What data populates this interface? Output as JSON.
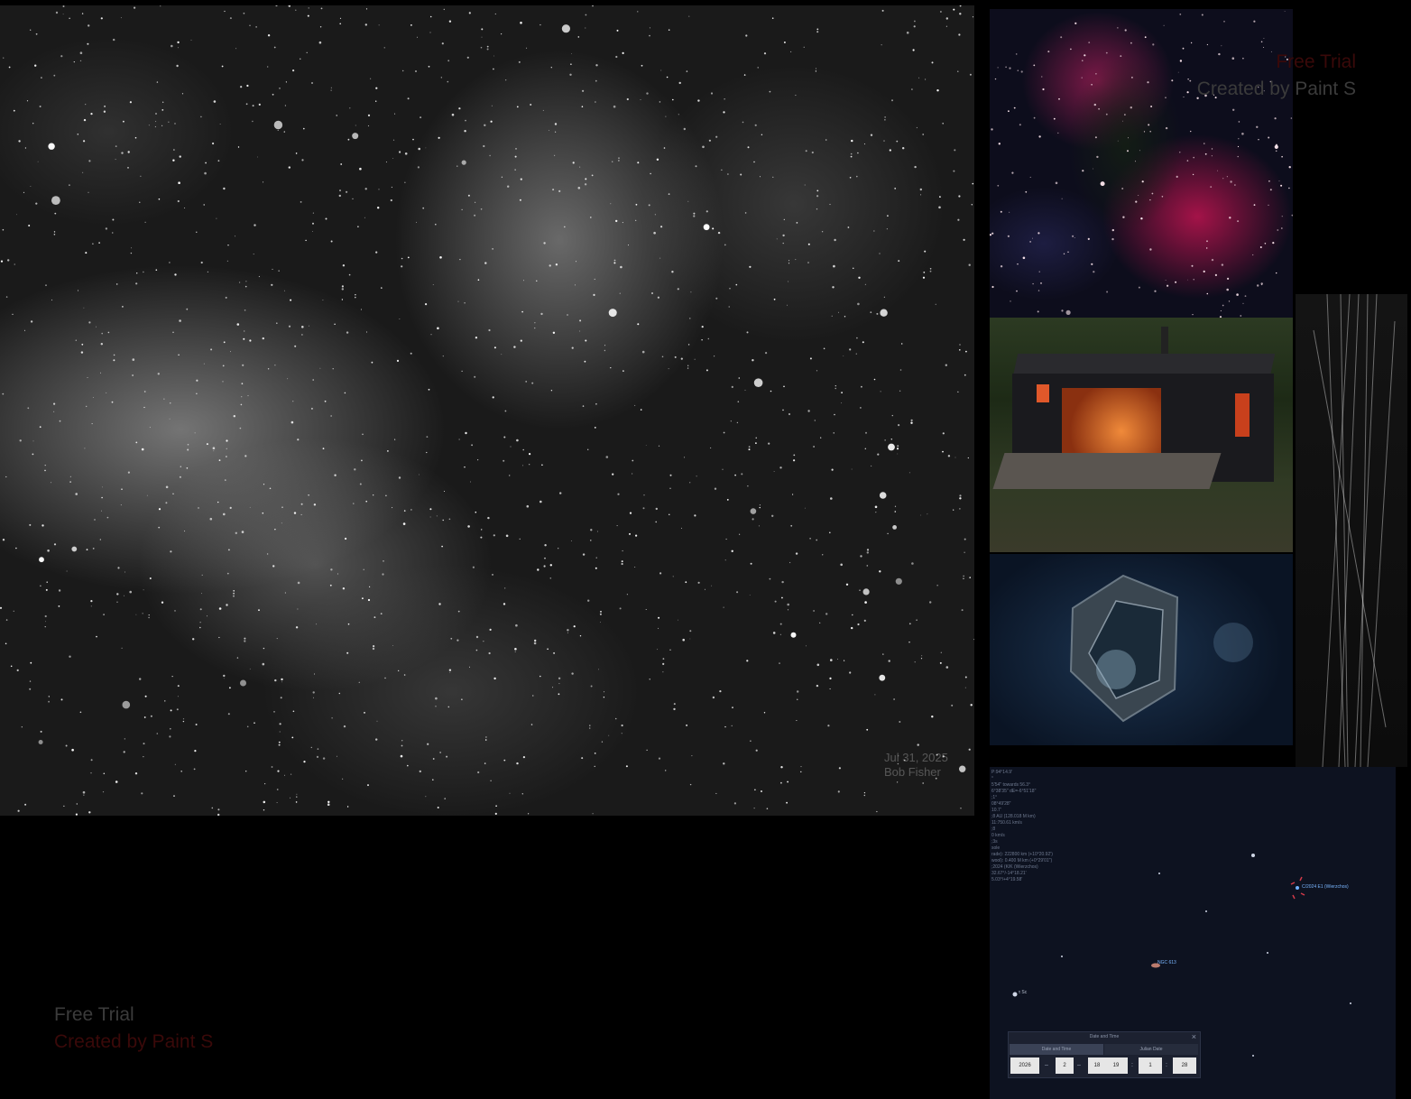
{
  "watermark_top": {
    "line1": "Free Trial",
    "line2": "Created by Paint S"
  },
  "watermark_bottom": {
    "line1": "Free Trial",
    "line2": "Created by Paint S"
  },
  "main_image": {
    "caption_line1": "Jul 31, 2025",
    "caption_line2": "Bob Fisher"
  },
  "stellarium": {
    "info_lines": [
      "P:94°14.9'",
      "°",
      "5'54\" towards 56.3°",
      "6°38'35\"  dE=-6°51'18\"",
      "  ;1°",
      "08°49'28\"",
      "  10.7'",
      "  ;8 AU (128.018 M km)",
      "  11:750.61 km/s",
      "  ;8",
      "  0 km/s",
      "  ;3s",
      "  sole",
      "  rade): 222800 km (+10°20.92')",
      "  wool): 0.400 M km (+0°29'01\")",
      "  ;2024 (K/K (Wierzchos)",
      "  32.67°/-14°18.21'",
      "  5.03°/+4°19.58'"
    ],
    "comet_label": "C/2024 E1 (Wierzchos)",
    "galaxy_label": "NGC 613",
    "star_label": "τ Sc",
    "dialog": {
      "title": "Date and Time",
      "tab_date": "Date and Time",
      "tab_julian": "Julian Date",
      "year": "2026",
      "month": "2",
      "day": "18",
      "hour": "19",
      "minute": "1",
      "second": "28",
      "close": "×"
    }
  }
}
